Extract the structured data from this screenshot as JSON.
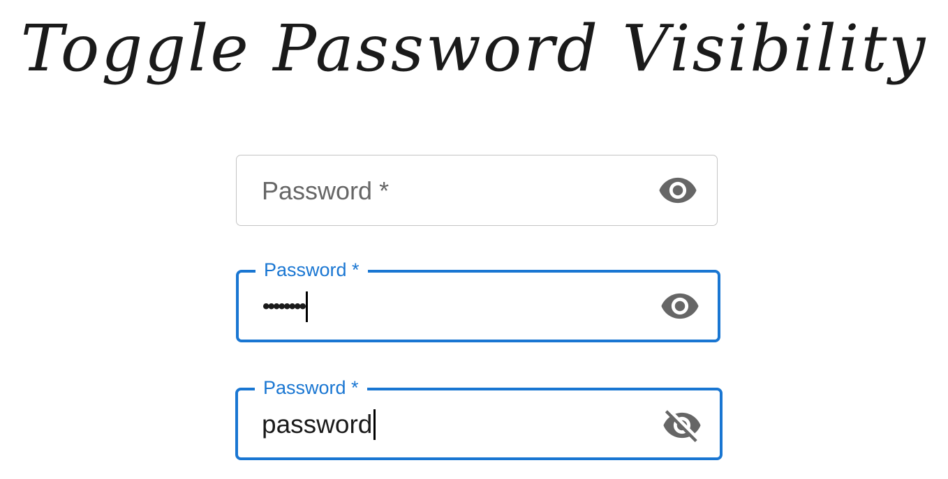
{
  "title": "Toggle Password Visibility",
  "fields": [
    {
      "state": "empty",
      "placeholder": "Password *",
      "icon": "eye-icon"
    },
    {
      "state": "focused-hidden",
      "label": "Password *",
      "value_display": "••••••••",
      "icon": "eye-icon"
    },
    {
      "state": "focused-visible",
      "label": "Password *",
      "value": "password",
      "icon": "eye-off-icon"
    }
  ],
  "colors": {
    "accent": "#1976d2",
    "idle_border": "#c4c4c4",
    "placeholder": "#666666",
    "icon": "#666666",
    "text": "#1a1a1a"
  }
}
